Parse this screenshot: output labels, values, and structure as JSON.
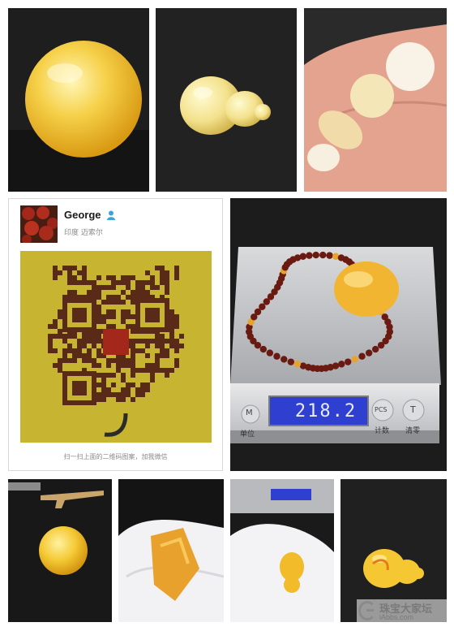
{
  "contact_card": {
    "name": "George",
    "region": "印度 迈索尔",
    "qr_caption": "扫一扫上面的二维码图案，加我微信"
  },
  "scale": {
    "readout": "218.2",
    "units_label": "单位",
    "count_label": "计数",
    "tare_label": "清零",
    "m_button": "M",
    "pcs_button": "PCS",
    "t_button": "T"
  },
  "watermark": {
    "site_name": "珠宝大家坛",
    "domain": "iAbbs.com"
  },
  "colors": {
    "amber_yellow": "#f2c02a",
    "beeswax_cream": "#f3e2a6",
    "qr_background": "#c7b532",
    "qr_modules": "#5a2a18",
    "scale_display": "#2f3fd0"
  }
}
